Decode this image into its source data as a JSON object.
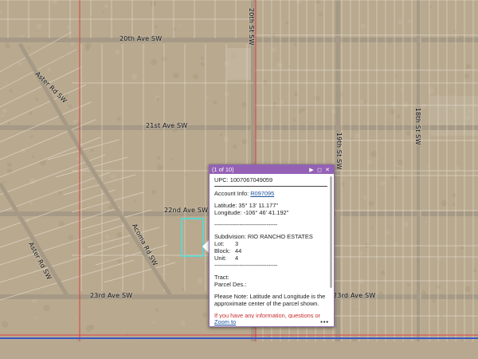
{
  "map": {
    "road_labels": [
      {
        "name": "road-20th-ave",
        "text": "20th Ave SW"
      },
      {
        "name": "road-21st-ave",
        "text": "21st Ave SW"
      },
      {
        "name": "road-22nd-ave",
        "text": "22nd Ave SW"
      },
      {
        "name": "road-23rd-ave-left",
        "text": "23rd Ave SW"
      },
      {
        "name": "road-23rd-ave-right",
        "text": "23rd Ave SW"
      },
      {
        "name": "road-aster-rd-upper",
        "text": "Aster Rd SW"
      },
      {
        "name": "road-aster-rd-lower",
        "text": "Aster Rd SW"
      },
      {
        "name": "road-acoma-rd",
        "text": "Acoma Rd SW"
      },
      {
        "name": "road-20th-st",
        "text": "20th St SW"
      },
      {
        "name": "road-19th-st",
        "text": "19th St SW"
      },
      {
        "name": "road-18th-st",
        "text": "18th St SW"
      }
    ],
    "colors": {
      "terrain": "#b9a98f",
      "parcel_lines": "#e3dccd",
      "road": "#a69a86",
      "red_boundary": "#e04040",
      "blue_boundary": "#3b57c8",
      "selection": "#48e0e0"
    }
  },
  "popup": {
    "header": {
      "count": "(1 of 10)",
      "next_icon": "play-icon",
      "max_icon": "maximize-icon",
      "close_icon": "close-icon"
    },
    "upc": "UPC: 1007067049059",
    "account_label": "Account Info: ",
    "account_link": "R097095",
    "latitude": "Latitude: 35° 13' 11.177\"",
    "longitude": "Longitude: -106° 46' 41.192\"",
    "dashes1": "-----------------------------------",
    "subdivision": "Subdivision: RIO RANCHO ESTATES",
    "lot_label": "Lot:",
    "lot_value": "3",
    "block_label": "Block:",
    "block_value": "44",
    "unit_label": "Unit:",
    "unit_value": "4",
    "dashes2": "-----------------------------------",
    "tract": "Tract:",
    "parcel_des": "Parcel Des.:",
    "note": "Please Note: Latitude and Longitude is the approximate center of the parcel shown.",
    "warn": "If you have any information, questions or concerns about this parcel, please contact",
    "zoom_to": "Zoom to",
    "more": "•••"
  }
}
